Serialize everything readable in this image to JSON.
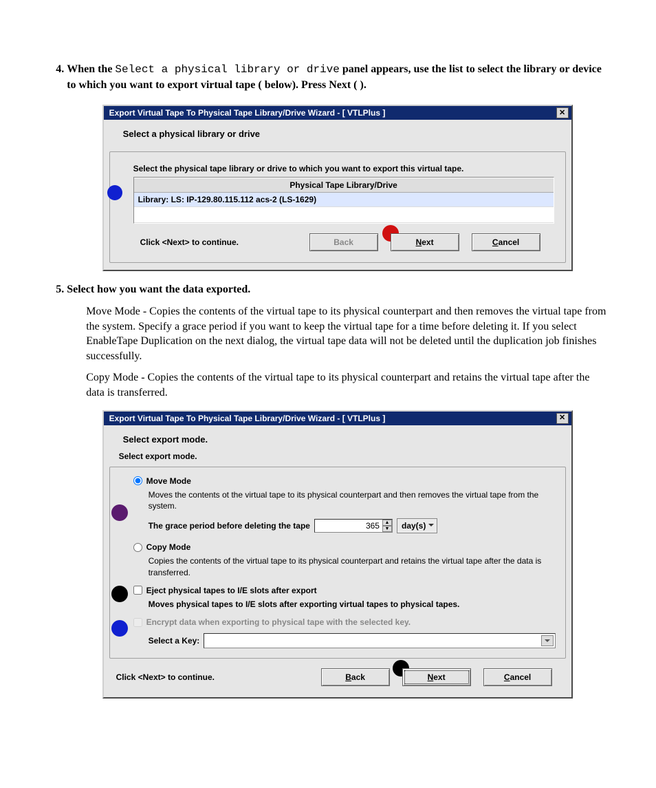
{
  "step4": {
    "lead_prefix": "When the ",
    "code": "Select a physical library or drive",
    "lead_suffix": " panel appears, use the list to select the library or device to which you want to export virtual tape (   below). Press Next (  )."
  },
  "step5": {
    "heading": "Select how you want the data exported.",
    "move_para": "Move Mode - Copies the contents of the virtual tape to its physical counterpart and then removes the virtual tape from the system. Specify a grace period if you want to keep the virtual tape for a time before deleting it. If you select EnableTape Duplication on the next dialog, the virtual tape data will not be deleted until the duplication job finishes successfully.",
    "copy_para": "Copy Mode - Copies the contents of the virtual tape to its physical counterpart and retains the virtual tape after the data is transferred."
  },
  "dialog1": {
    "title": "Export Virtual Tape To Physical Tape Library/Drive Wizard - [ VTLPlus ]",
    "subtitle": "Select a physical library or drive",
    "instruction": "Select the physical tape library or drive to which you want to export this virtual tape.",
    "column_header": "Physical Tape Library/Drive",
    "row1": "Library: LS: IP-129.80.115.112 acs-2 (LS-1629)",
    "footer_hint": "Click <Next> to continue.",
    "back": "Back",
    "next_pre": "N",
    "next_rest": "ext",
    "cancel_pre": "C",
    "cancel_rest": "ancel"
  },
  "dialog2": {
    "title": "Export Virtual Tape To Physical Tape Library/Drive Wizard - [ VTLPlus ]",
    "subtitle": "Select export mode.",
    "panel_heading": "Select export mode.",
    "move_label": "Move Mode",
    "move_desc": "Moves the contents ot the virtual tape to its physical counterpart and then removes the virtual tape from the system.",
    "grace_label": "The grace period before deleting the tape",
    "grace_value": "365",
    "grace_unit": "day(s)",
    "copy_label": "Copy Mode",
    "copy_desc": "Copies the contents of the virtual tape to its physical counterpart and retains the virtual tape after the data is transferred.",
    "eject_label": "Eject physical tapes to I/E slots after export",
    "eject_desc": "Moves physical tapes to I/E slots after exporting virtual tapes to physical tapes.",
    "encrypt_label": "Encrypt data when exporting to physical tape with the selected key.",
    "select_key_label": "Select a Key:",
    "footer_hint": "Click <Next> to continue.",
    "back_pre": "B",
    "back_rest": "ack",
    "next_pre": "N",
    "next_rest": "ext",
    "cancel_pre": "C",
    "cancel_rest": "ancel"
  }
}
